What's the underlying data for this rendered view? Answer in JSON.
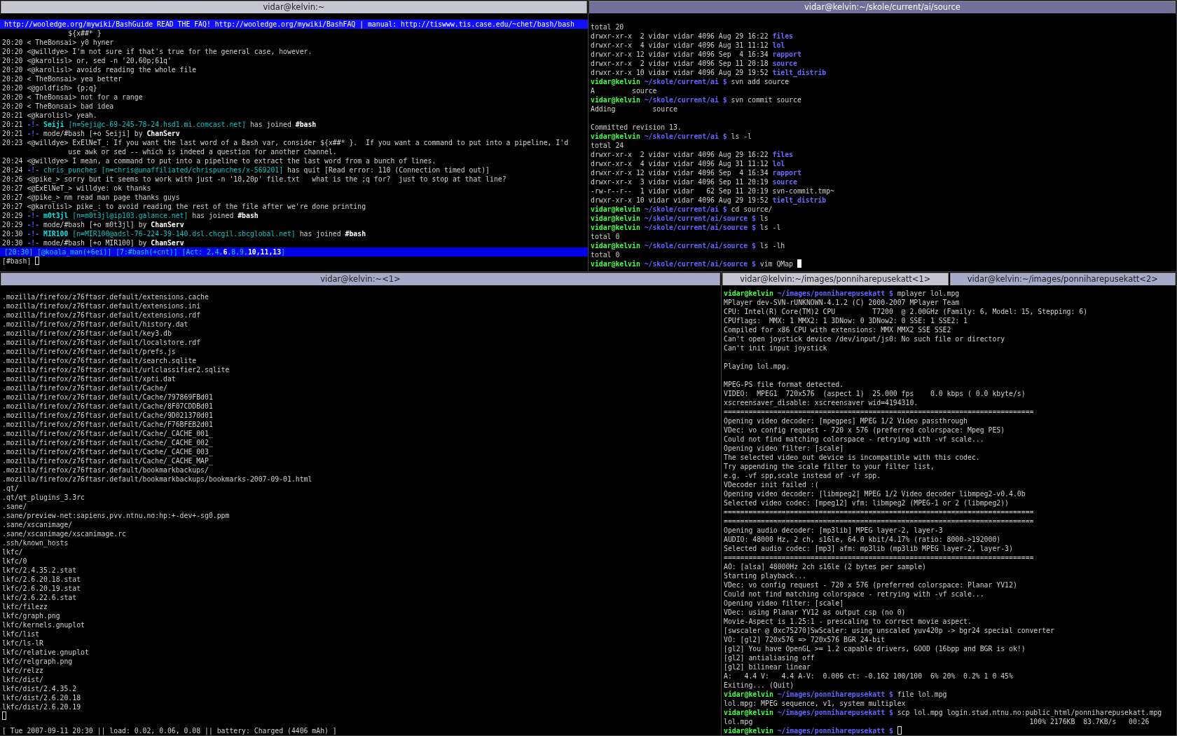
{
  "top_frames": [
    {
      "kind": "irc",
      "focused": false,
      "tabs": [
        {
          "label": "vidar@kelvin:~",
          "selected": false
        }
      ],
      "topic": "http://wooledge.org/mywiki/BashGuide READ THE FAQ! http://wooledge.org/mywiki/BashFAQ | manual: http://tiswww.tis.case.edu/~chet/bash/bash",
      "topic_continued": "${x##* }",
      "lines": [
        {
          "time": "20:20",
          "segments": [
            {
              "text": "< TheBonsai> y0 hyner",
              "kind": "message"
            }
          ]
        },
        {
          "time": "20:20",
          "segments": [
            {
              "text": "<@willdye> I'm not sure if that's true for the general case, however.",
              "kind": "message"
            }
          ]
        },
        {
          "time": "20:20",
          "segments": [
            {
              "text": "<@karolisl> or, sed -n '20,60p;61q'",
              "kind": "message"
            }
          ]
        },
        {
          "time": "20:20",
          "segments": [
            {
              "text": "<@karolisl> avoids reading the whole file",
              "kind": "message"
            }
          ]
        },
        {
          "time": "20:20",
          "segments": [
            {
              "text": "< TheBonsai> yea better",
              "kind": "message"
            }
          ]
        },
        {
          "time": "20:20",
          "segments": [
            {
              "text": "<@goldfish> {p;q}",
              "kind": "message"
            }
          ]
        },
        {
          "time": "20:20",
          "segments": [
            {
              "text": "< TheBonsai> not for a range",
              "kind": "message"
            }
          ]
        },
        {
          "time": "20:20",
          "segments": [
            {
              "text": "< TheBonsai> bad idea",
              "kind": "message"
            }
          ]
        },
        {
          "time": "20:21",
          "segments": [
            {
              "text": "<@karolisl> yeah.",
              "kind": "message"
            }
          ]
        },
        {
          "time": "20:21",
          "segments": [
            {
              "text": "-!-",
              "kind": "marker"
            },
            {
              "text": "Seiji",
              "kind": "nick"
            },
            {
              "text": "[n=Seji@c-69-245-78-24.hsd1.mi.comcast.net]",
              "kind": "host"
            },
            {
              "text": "has joined",
              "kind": "message"
            },
            {
              "text": "#bash",
              "kind": "bold"
            }
          ]
        },
        {
          "time": "20:21",
          "segments": [
            {
              "text": "-!-",
              "kind": "marker"
            },
            {
              "text": "mode/#bash [+o Seiji] by",
              "kind": "message"
            },
            {
              "text": "ChanServ",
              "kind": "bold"
            }
          ]
        },
        {
          "time": "20:23",
          "segments": [
            {
              "text": "<@willdye> ExElNeT_: If you want the last word of a Bash var, consider ${x##* }.  If you want a command to put into a pipeline, I'd",
              "kind": "message"
            }
          ],
          "continued": "use awk or sed -- which is indeed a question for another channel."
        },
        {
          "time": "20:24",
          "segments": [
            {
              "text": "<@willdye> I mean, a command to put into a pipeline to extract the last word from a bunch of lines.",
              "kind": "message"
            }
          ]
        },
        {
          "time": "20:24",
          "segments": [
            {
              "text": "-!-",
              "kind": "marker"
            },
            {
              "text": "chris_punches",
              "kind": "host"
            },
            {
              "text": "[n=chris@unaffiliated/chrispunches/x-569201]",
              "kind": "host"
            },
            {
              "text": "has quit [Read error: 110 (Connection timed out)]",
              "kind": "message"
            }
          ]
        },
        {
          "time": "20:26",
          "segments": [
            {
              "text": "<@pike_> sorry but it seems to work with just -n '10,20p' file.txt   what is the ;q for?  just to stop at that line?",
              "kind": "message"
            }
          ]
        },
        {
          "time": "20:27",
          "segments": [
            {
              "text": "<@ExElNeT_> willdye: ok thanks",
              "kind": "message"
            }
          ]
        },
        {
          "time": "20:27",
          "segments": [
            {
              "text": "<@pike_> nm read man page thanks guys",
              "kind": "message"
            }
          ]
        },
        {
          "time": "20:27",
          "segments": [
            {
              "text": "<@karolisl> pike_: to avoid reading the rest of the file after we're done printing",
              "kind": "message"
            }
          ]
        },
        {
          "time": "20:29",
          "segments": [
            {
              "text": "-!-",
              "kind": "marker"
            },
            {
              "text": "m0t3jl",
              "kind": "nick"
            },
            {
              "text": "[n=m0t3jl@ip103.galance.net]",
              "kind": "host"
            },
            {
              "text": "has joined",
              "kind": "message"
            },
            {
              "text": "#bash",
              "kind": "bold"
            }
          ]
        },
        {
          "time": "20:29",
          "segments": [
            {
              "text": "-!-",
              "kind": "marker"
            },
            {
              "text": "mode/#bash [+o m0t3jl] by",
              "kind": "message"
            },
            {
              "text": "ChanServ",
              "kind": "bold"
            }
          ]
        },
        {
          "time": "20:30",
          "segments": [
            {
              "text": "-!-",
              "kind": "marker"
            },
            {
              "text": "MIR100",
              "kind": "nick"
            },
            {
              "text": "[n=MIR100@adsl-76-224-39-140.dsl.chcgil.sbcglobal.net]",
              "kind": "host"
            },
            {
              "text": "has joined",
              "kind": "message"
            },
            {
              "text": "#bash",
              "kind": "bold"
            }
          ]
        },
        {
          "time": "20:30",
          "segments": [
            {
              "text": "-!-",
              "kind": "marker"
            },
            {
              "text": "mode/#bash [+o MIR100] by",
              "kind": "message"
            },
            {
              "text": "ChanServ",
              "kind": "bold"
            }
          ]
        }
      ],
      "status_bar": {
        "items": [
          "[20:30]",
          "[@koala_man(+6ei)]",
          "[7:#bash(+cnt)]"
        ],
        "activity_label": "[Act:",
        "activity": [
          {
            "text": "2,4,",
            "highlight": false
          },
          {
            "text": "6",
            "highlight": true
          },
          {
            "text": ",8,9,",
            "highlight": false
          },
          {
            "text": "10,11,13",
            "highlight": true
          }
        ],
        "activity_end": "]"
      },
      "input": {
        "prompt": "[#bash]",
        "cursor": true
      }
    },
    {
      "kind": "shell",
      "focused": true,
      "tabs": [
        {
          "label": "vidar@kelvin:~/skole/current/ai/source",
          "selected": true
        }
      ],
      "lines": [
        "total 20",
        {
          "kind": "dir-entry",
          "details": "drwxr-xr-x  2 vidar vidar 4096 Aug 29 16:22",
          "name": "files"
        },
        {
          "kind": "dir-entry",
          "details": "drwxr-xr-x  4 vidar vidar 4096 Aug 31 11:12",
          "name": "lol"
        },
        {
          "kind": "dir-entry",
          "details": "drwxr-xr-x 12 vidar vidar 4096 Sep  4 16:34",
          "name": "rapport"
        },
        {
          "kind": "dir-entry",
          "details": "drwxr-xr-x  2 vidar vidar 4096 Sep 11 20:18",
          "name": "source"
        },
        {
          "kind": "dir-entry",
          "details": "drwxr-xr-x 10 vidar vidar 4096 Aug 29 19:52",
          "name": "tielt_distrib"
        },
        {
          "kind": "prompt",
          "user": "vidar@kelvin",
          "path": "~/skole/current/ai",
          "sign": "$",
          "command": "svn add source"
        },
        "A         source",
        {
          "kind": "prompt",
          "user": "vidar@kelvin",
          "path": "~/skole/current/ai",
          "sign": "$",
          "command": "svn commit source"
        },
        "Adding         source",
        {
          "kind": "blank"
        },
        "Committed revision 13.",
        {
          "kind": "prompt",
          "user": "vidar@kelvin",
          "path": "~/skole/current/ai",
          "sign": "$",
          "command": "ls -l"
        },
        "total 24",
        {
          "kind": "dir-entry",
          "details": "drwxr-xr-x  2 vidar vidar 4096 Aug 29 16:22",
          "name": "files"
        },
        {
          "kind": "dir-entry",
          "details": "drwxr-xr-x  4 vidar vidar 4096 Aug 31 11:12",
          "name": "lol"
        },
        {
          "kind": "dir-entry",
          "details": "drwxr-xr-x 12 vidar vidar 4096 Sep  4 16:34",
          "name": "rapport"
        },
        {
          "kind": "dir-entry",
          "details": "drwxr-xr-x  3 vidar vidar 4096 Sep 11 20:19",
          "name": "source"
        },
        {
          "kind": "file-entry",
          "details": "-rw-r--r--  1 vidar vidar   62 Sep 11 20:19",
          "name": "svn-commit.tmp~"
        },
        {
          "kind": "dir-entry",
          "details": "drwxr-xr-x 10 vidar vidar 4096 Aug 29 19:52",
          "name": "tielt_distrib"
        },
        {
          "kind": "prompt",
          "user": "vidar@kelvin",
          "path": "~/skole/current/ai",
          "sign": "$",
          "command": "cd source/"
        },
        {
          "kind": "prompt",
          "user": "vidar@kelvin",
          "path": "~/skole/current/ai/source",
          "sign": "$",
          "command": "ls"
        },
        {
          "kind": "prompt",
          "user": "vidar@kelvin",
          "path": "~/skole/current/ai/source",
          "sign": "$",
          "command": "ls -l"
        },
        "total 0",
        {
          "kind": "prompt",
          "user": "vidar@kelvin",
          "path": "~/skole/current/ai/source",
          "sign": "$",
          "command": "ls -lh"
        },
        "total 0",
        {
          "kind": "prompt",
          "user": "vidar@kelvin",
          "path": "~/skole/current/ai/source",
          "sign": "$",
          "command": "vim QMap",
          "cursor": true
        }
      ]
    }
  ],
  "bottom_frames": [
    {
      "kind": "shell",
      "focused": false,
      "tabs": [
        {
          "label": "vidar@kelvin:~<1>",
          "selected": true
        }
      ],
      "lines": [
        ".mozilla/firefox/z76ftasr.default/extensions.cache",
        ".mozilla/firefox/z76ftasr.default/extensions.ini",
        ".mozilla/firefox/z76ftasr.default/extensions.rdf",
        ".mozilla/firefox/z76ftasr.default/history.dat",
        ".mozilla/firefox/z76ftasr.default/key3.db",
        ".mozilla/firefox/z76ftasr.default/localstore.rdf",
        ".mozilla/firefox/z76ftasr.default/prefs.js",
        ".mozilla/firefox/z76ftasr.default/search.sqlite",
        ".mozilla/firefox/z76ftasr.default/urlclassifier2.sqlite",
        ".mozilla/firefox/z76ftasr.default/xpti.dat",
        ".mozilla/firefox/z76ftasr.default/Cache/",
        ".mozilla/firefox/z76ftasr.default/Cache/797869FBd01",
        ".mozilla/firefox/z76ftasr.default/Cache/8F07CDDBd01",
        ".mozilla/firefox/z76ftasr.default/Cache/9D021370d01",
        ".mozilla/firefox/z76ftasr.default/Cache/F76BFEB2d01",
        ".mozilla/firefox/z76ftasr.default/Cache/_CACHE_001_",
        ".mozilla/firefox/z76ftasr.default/Cache/_CACHE_002_",
        ".mozilla/firefox/z76ftasr.default/Cache/_CACHE_003_",
        ".mozilla/firefox/z76ftasr.default/Cache/_CACHE_MAP_",
        ".mozilla/firefox/z76ftasr.default/bookmarkbackups/",
        ".mozilla/firefox/z76ftasr.default/bookmarkbackups/bookmarks-2007-09-01.html",
        ".qt/",
        ".qt/qt_plugins_3.3rc",
        ".sane/",
        ".sane/preview-net:sapiens.pvv.ntnu.no:hp:+-dev+-sg0.ppm",
        ".sane/xscanimage/",
        ".sane/xscanimage/xscanimage.rc",
        ".ssh/known_hosts",
        "lkfc/",
        "lkfc/0",
        "lkfc/2.4.35.2.stat",
        "lkfc/2.6.20.18.stat",
        "lkfc/2.6.20.19.stat",
        "lkfc/2.6.22.6.stat",
        "lkfc/filezz",
        "lkfc/graph.png",
        "lkfc/kernels.gnuplot",
        "lkfc/list",
        "lkfc/ls-lR",
        "lkfc/relative.gnuplot",
        "lkfc/relgraph.png",
        "lkfc/relzz",
        "lkfc/dist/",
        "lkfc/dist/2.4.35.2",
        "lkfc/dist/2.6.20.18",
        "lkfc/dist/2.6.20.19",
        {
          "kind": "blank",
          "cursor": true
        }
      ],
      "footer": "[ Tue 2007-09-11 20:30 || load: 0.02, 0.06, 0.08 || battery: Charged (4406 mAh) ]"
    },
    {
      "kind": "shell",
      "focused": false,
      "tabs": [
        {
          "label": "vidar@kelvin:~/images/ponniharepusekatt<1>",
          "selected": false
        },
        {
          "label": "vidar@kelvin:~/images/ponniharepusekatt<2>",
          "selected": true
        }
      ],
      "lines": [
        {
          "kind": "prompt",
          "user": "vidar@kelvin",
          "path": "~/images/ponniharepusekatt",
          "sign": "$",
          "command": "mplayer lol.mpg"
        },
        "MPlayer dev-SVN-rUNKNOWN-4.1.2 (C) 2000-2007 MPlayer Team",
        "CPU: Intel(R) Core(TM)2 CPU         T7200  @ 2.00GHz (Family: 6, Model: 15, Stepping: 6)",
        "CPUflags:  MMX: 1 MMX2: 1 3DNow: 0 3DNow2: 0 SSE: 1 SSE2: 1",
        "Compiled for x86 CPU with extensions: MMX MMX2 SSE SSE2",
        "Can't open joystick device /dev/input/js0: No such file or directory",
        "Can't init input joystick",
        {
          "kind": "blank"
        },
        "Playing lol.mpg.",
        {
          "kind": "blank"
        },
        "MPEG-PS file format detected.",
        "VIDEO:  MPEG1  720x576  (aspect 1)  25.000 fps    0.0 kbps ( 0.0 kbyte/s)",
        "xscreensaver_disable: xscreensaver wid=4194310.",
        "===========================================================================",
        "Opening video decoder: [mpegpes] MPEG 1/2 Video passthrough",
        "VDec: vo config request - 720 x 576 (preferred colorspace: Mpeg PES)",
        "Could not find matching colorspace - retrying with -vf scale...",
        "Opening video filter: [scale]",
        "The selected video_out device is incompatible with this codec.",
        "Try appending the scale filter to your filter list,",
        "e.g. -vf spp,scale instead of -vf spp.",
        "VDecoder init failed :(",
        "Opening video decoder: [libmpeg2] MPEG 1/2 Video decoder libmpeg2-v0.4.0b",
        "Selected video codec: [mpeg12] vfm: libmpeg2 (MPEG-1 or 2 (libmpeg2))",
        "===========================================================================",
        "===========================================================================",
        "Opening audio decoder: [mp3lib] MPEG layer-2, layer-3",
        "AUDIO: 48000 Hz, 2 ch, s16le, 64.0 kbit/4.17% (ratio: 8000->192000)",
        "Selected audio codec: [mp3] afm: mp3lib (mp3lib MPEG layer-2, layer-3)",
        "===========================================================================",
        "AO: [alsa] 48000Hz 2ch s16le (2 bytes per sample)",
        "Starting playback...",
        "VDec: vo config request - 720 x 576 (preferred colorspace: Planar YV12)",
        "Could not find matching colorspace - retrying with -vf scale...",
        "Opening video filter: [scale]",
        "VDec: using Planar YV12 as output csp (no 0)",
        "Movie-Aspect is 1.25:1 - prescaling to correct movie aspect.",
        "[swscaler @ 0xc75270]SwScaler: using unscaled yuv420p -> bgr24 special converter",
        "VO: [gl2] 720x576 => 720x576 BGR 24-bit",
        "[gl2] You have OpenGL >= 1.2 capable drivers, GOOD (16bpp and BGR is ok!)",
        "[gl2] antialiasing off",
        "[gl2] bilinear linear",
        "A:   4.4 V:   4.4 A-V:  0.006 ct: -0.162 100/100  6% 20%  0.2% 1 0 45%",
        "Exiting... (Quit)",
        {
          "kind": "prompt",
          "user": "vidar@kelvin",
          "path": "~/images/ponniharepusekatt",
          "sign": "$",
          "command": "file lol.mpg"
        },
        "lol.mpg: MPEG sequence, v1, system multiplex",
        {
          "kind": "prompt",
          "user": "vidar@kelvin",
          "path": "~/images/ponniharepusekatt",
          "sign": "$",
          "command": "scp lol.mpg login.stud.ntnu.no:public_html/ponniharepusekatt.mpg"
        },
        {
          "kind": "transfer",
          "file": "lol.mpg",
          "progress": "100% 2176KB  83.7KB/s   00:26"
        },
        {
          "kind": "prompt",
          "user": "vidar@kelvin",
          "path": "~/images/ponniharepusekatt",
          "sign": "$",
          "cursor": true
        }
      ]
    }
  ]
}
